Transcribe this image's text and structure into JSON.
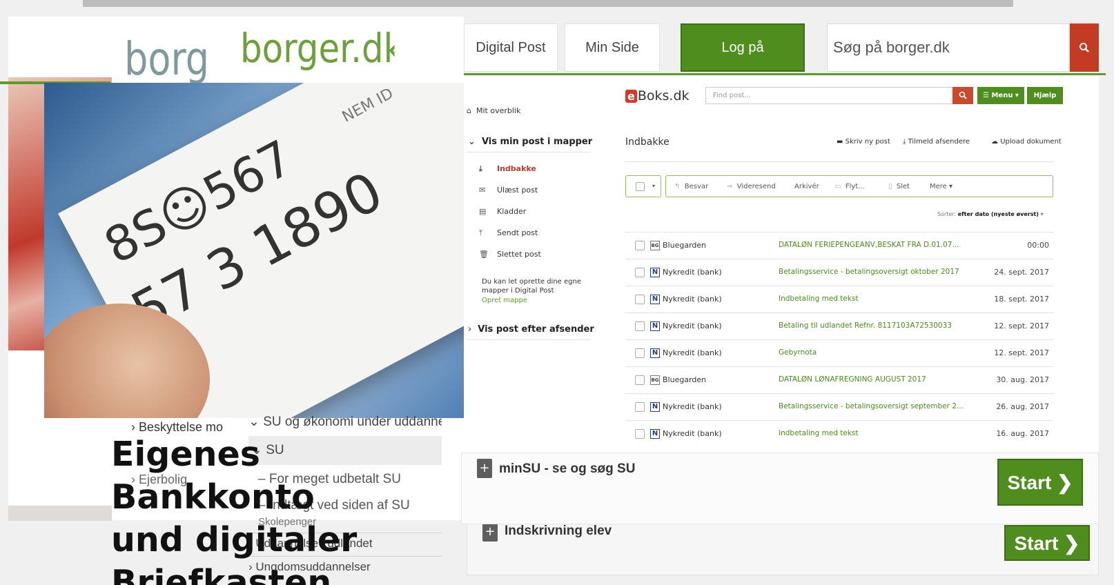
{
  "borger": {
    "logo_fragment": "borge",
    "logo": "borger.dk",
    "nav": {
      "digital_post": "Digital Post",
      "min_side": "Min Side",
      "log_paa": "Log på"
    },
    "search_placeholder": "Søg på borger.dk"
  },
  "colors": {
    "brand_green": "#4f8d1e",
    "accent_red": "#c23b22",
    "link_green": "#4b8a1d"
  },
  "card_photo": {
    "line1": "8S☺567",
    "line2": "57 3 1890",
    "line3": "NEM ID"
  },
  "left_menu": {
    "beskyttelse": "Beskyttelse mo",
    "ejerbolig": "Ejerbolig"
  },
  "su_menu": {
    "items": [
      "SU og økonomi under uddannelse",
      "SU",
      "For meget udbetalt SU",
      "Indtægt ved siden af SU",
      "Skolepenger",
      "Uddannelse i udlandet",
      "Ungdomsuddannelser"
    ]
  },
  "headline": {
    "line1": "Eigenes",
    "line2": "Bankkonto",
    "line3": "und digitaler",
    "line4": "Briefkasten"
  },
  "eboks": {
    "logo_e": "e",
    "logo_rest": "Boks.dk",
    "find_placeholder": "Find post...",
    "menu_label": "☰ Menu ▾",
    "help_label": "Hjælp",
    "overview": "Mit overblik",
    "folders_heading": "Vis min post i mapper",
    "folders": [
      "Indbakke",
      "Ulæst post",
      "Kladder",
      "Sendt post",
      "Slettet post"
    ],
    "folders_note": "Du kan let oprette dine egne mapper i Digital Post",
    "create_folder": "Opret mappe",
    "senders_heading": "Vis post efter afsender",
    "inbox_title": "Indbakke",
    "actions": {
      "write": "Skriv ny post",
      "subscribe": "Tilmeld afsendere",
      "upload": "Upload dokument"
    },
    "toolbar": {
      "reply": "Besvar",
      "forward": "Videresend",
      "archive": "Arkivér",
      "move": "Flyt...",
      "delete": "Slet",
      "more": "Mere ▾"
    },
    "sort_label": "Sorter:",
    "sort_value": "efter dato (nyeste øverst)",
    "messages": [
      {
        "sender": "Bluegarden",
        "subject": "DATALØN FERIEPENGEANV,BESKAT FRA D.01.07...",
        "date": "00:00",
        "icon": "BG"
      },
      {
        "sender": "Nykredit (bank)",
        "subject": "Betalingsservice - betalingsoversigt oktober 2017",
        "date": "24. sept. 2017",
        "icon": "N"
      },
      {
        "sender": "Nykredit (bank)",
        "subject": "Indbetaling med tekst",
        "date": "18. sept. 2017",
        "icon": "N"
      },
      {
        "sender": "Nykredit (bank)",
        "subject": "Betaling til udlandet Refnr. 8117103A72530033",
        "date": "12. sept. 2017",
        "icon": "N"
      },
      {
        "sender": "Nykredit (bank)",
        "subject": "Gebyrnota",
        "date": "12. sept. 2017",
        "icon": "N"
      },
      {
        "sender": "Bluegarden",
        "subject": "DATALØN LØNAFREGNING AUGUST 2017",
        "date": "30. aug. 2017",
        "icon": "BG"
      },
      {
        "sender": "Nykredit (bank)",
        "subject": "Betalingsservice - betalingsoversigt september 2...",
        "date": "26. aug. 2017",
        "icon": "N"
      },
      {
        "sender": "Nykredit (bank)",
        "subject": "Indbetaling med tekst",
        "date": "16. aug. 2017",
        "icon": "N"
      }
    ]
  },
  "minsu": {
    "title": "minSU - se og søg SU",
    "start": "Start ❯",
    "title2": "Indskrivning elev",
    "start2": "Start ❯",
    "plus": "+"
  }
}
